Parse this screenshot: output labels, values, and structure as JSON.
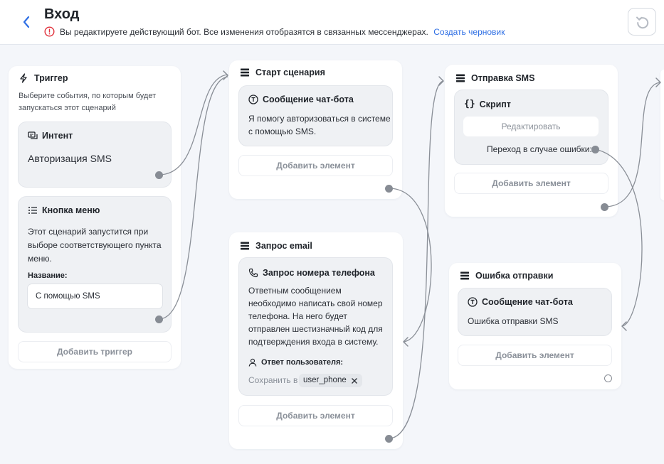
{
  "header": {
    "title": "Вход",
    "warning": "Вы редактируете действующий бот. Все изменения отобразятся в связанных мессенджерах.",
    "draft_link": "Создать черновик"
  },
  "colors": {
    "link": "#2f6fe4",
    "warning": "#e0303b",
    "wire": "#8a8f97"
  },
  "trigger": {
    "title": "Триггер",
    "description": "Выберите события, по которым будет запускаться этот сценарий",
    "intent": {
      "title": "Интент",
      "value": "Авторизация SMS"
    },
    "menu": {
      "title": "Кнопка меню",
      "text": "Этот сценарий запустится при выборе соответствующего пункта меню.",
      "name_label": "Название:",
      "name_value": "С помощью SMS"
    },
    "add_trigger": "Добавить триггер"
  },
  "start": {
    "title": "Старт сценария",
    "message_title": "Сообщение чат-бота",
    "message_text": "Я помогу авторизоваться в системе с помощью SMS.",
    "add_element": "Добавить элемент"
  },
  "email": {
    "title": "Запрос email",
    "request_title": "Запрос номера телефона",
    "request_text": "Ответным сообщением необходимо написать свой номер телефона. На него будет отправлен шестизначный код для подтверждения входа в систему.",
    "answer_label": "Ответ пользователя:",
    "save_to": "Сохранить в",
    "variable": "user_phone",
    "add_element": "Добавить элемент"
  },
  "sms": {
    "title": "Отправка SMS",
    "script_title": "Скрипт",
    "edit": "Редактировать",
    "error_transition": "Переход в случае ошибки:",
    "add_element": "Добавить элемент"
  },
  "error": {
    "title": "Ошибка отправки",
    "message_title": "Сообщение чат-бота",
    "message_text": "Ошибка отправки SMS",
    "add_element": "Добавить элемент"
  },
  "icons": {
    "back": "chevron-left-icon",
    "undo": "undo-icon",
    "trigger": "lightning-icon",
    "block": "stack-icon",
    "message": "text-t-icon",
    "script": "braces-icon",
    "phone": "phone-icon",
    "user": "user-icon",
    "intent": "chat-icon",
    "menu": "list-icon"
  }
}
